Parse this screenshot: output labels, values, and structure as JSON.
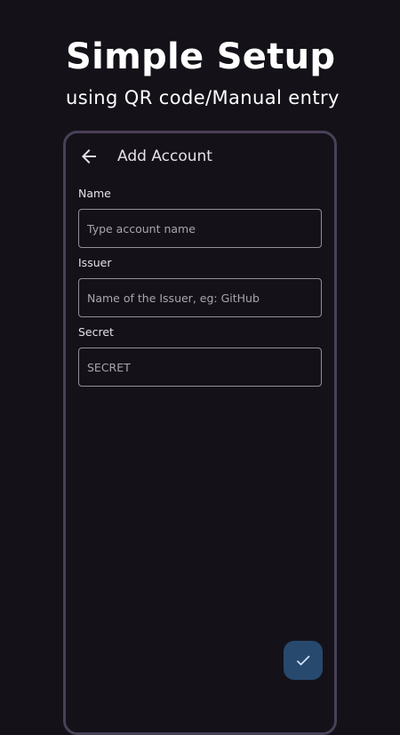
{
  "promo": {
    "title": "Simple Setup",
    "subtitle": "using QR code/Manual entry"
  },
  "appbar": {
    "back_icon": "arrow-back-icon",
    "title": "Add Account"
  },
  "form": {
    "name": {
      "label": "Name",
      "placeholder": "Type account name",
      "value": ""
    },
    "issuer": {
      "label": "Issuer",
      "placeholder": "Name of the Issuer, eg: GitHub",
      "value": ""
    },
    "secret": {
      "label": "Secret",
      "placeholder": "SECRET",
      "value": ""
    }
  },
  "fab": {
    "icon": "check-icon",
    "background": "#27496d"
  },
  "colors": {
    "background": "#141218",
    "frame": "#4a4058",
    "outline": "#938f99",
    "on_surface": "#e6e0e9"
  }
}
